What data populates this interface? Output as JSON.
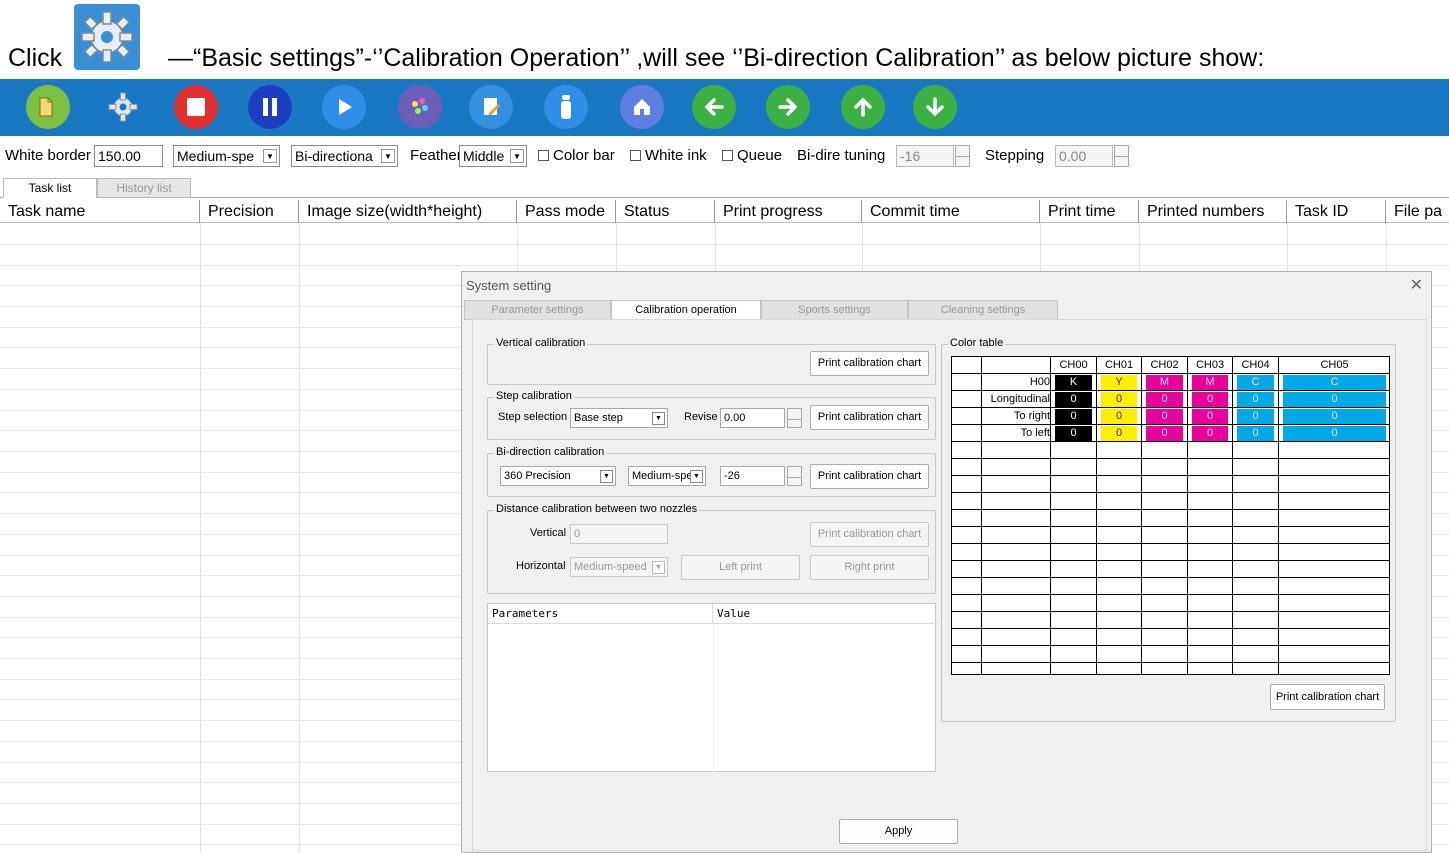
{
  "instruction": {
    "click_word": "Click",
    "text": "—“Basic settings”-‘’Calibration Operation’’ ,will see ‘’Bi-direction Calibration’’ as below picture show:"
  },
  "colors": {
    "toolbar": "#1a78c2",
    "black": "#000000",
    "yellow": "#ffee00",
    "magenta": "#e8009b",
    "cyan": "#00a8e6"
  },
  "toolbar": {
    "icons": [
      "open-icon",
      "settings-gear-icon",
      "stop-icon",
      "pause-icon",
      "play-icon",
      "color-palette-icon",
      "edit-icon",
      "ink-bottle-icon",
      "home-icon",
      "arrow-left-icon",
      "arrow-right-icon",
      "arrow-up-icon",
      "arrow-down-icon"
    ]
  },
  "options": {
    "white_border_label": "White border",
    "white_border_value": "150.00",
    "speed_value": "Medium-spe",
    "direction_value": "Bi-directiona",
    "feather_label": "Feather",
    "feather_value": "Middle",
    "color_bar": "Color bar",
    "white_ink": "White ink",
    "queue": "Queue",
    "bidir_tuning_label": "Bi-dire tuning",
    "bidir_tuning_value": "-16",
    "stepping_label": "Stepping",
    "stepping_value": "0.00"
  },
  "list_tabs": [
    "Task list",
    "History list"
  ],
  "columns": [
    "Task name",
    "Precision",
    "Image size(width*height)",
    "Pass mode",
    "Status",
    "Print progress",
    "Commit time",
    "Print time",
    "Printed numbers",
    "Task ID",
    "File pa"
  ],
  "dialog": {
    "title": "System setting",
    "close": "✕",
    "tabs": [
      "Parameter settings",
      "Calibration operation",
      "Sports settings",
      "Cleaning settings"
    ],
    "vertical": {
      "title": "Vertical calibration",
      "button": "Print calibration chart"
    },
    "step": {
      "title": "Step calibration",
      "selection_label": "Step selection",
      "selection_value": "Base step",
      "revise_label": "Revise",
      "revise_value": "0.00",
      "button": "Print calibration chart"
    },
    "bidir": {
      "title": "Bi-direction calibration",
      "precision_value": "360 Precision",
      "speed_value": "Medium-spe",
      "offset_value": "-26",
      "button": "Print calibration chart"
    },
    "distance": {
      "title": "Distance calibration between two nozzles",
      "vertical_label": "Vertical",
      "vertical_value": "0",
      "button": "Print calibration chart",
      "horizontal_label": "Horizontal",
      "horizontal_value": "Medium-speed",
      "left_print": "Left print",
      "right_print": "Right print"
    },
    "params": {
      "col1": "Parameters",
      "col2": "Value"
    },
    "color_table": {
      "title": "Color table",
      "channels": [
        "CH00",
        "CH01",
        "CH02",
        "CH03",
        "CH04",
        "CH05"
      ],
      "rows": [
        {
          "label": "H00",
          "values": [
            "K",
            "Y",
            "M",
            "M",
            "C",
            "C"
          ]
        },
        {
          "label": "Longitudinal",
          "values": [
            "0",
            "0",
            "0",
            "0",
            "0",
            "0"
          ]
        },
        {
          "label": "To right",
          "values": [
            "0",
            "0",
            "0",
            "0",
            "0",
            "0"
          ]
        },
        {
          "label": "To left",
          "values": [
            "0",
            "0",
            "0",
            "0",
            "0",
            "0"
          ]
        }
      ],
      "button": "Print calibration chart"
    },
    "apply": "Apply"
  }
}
